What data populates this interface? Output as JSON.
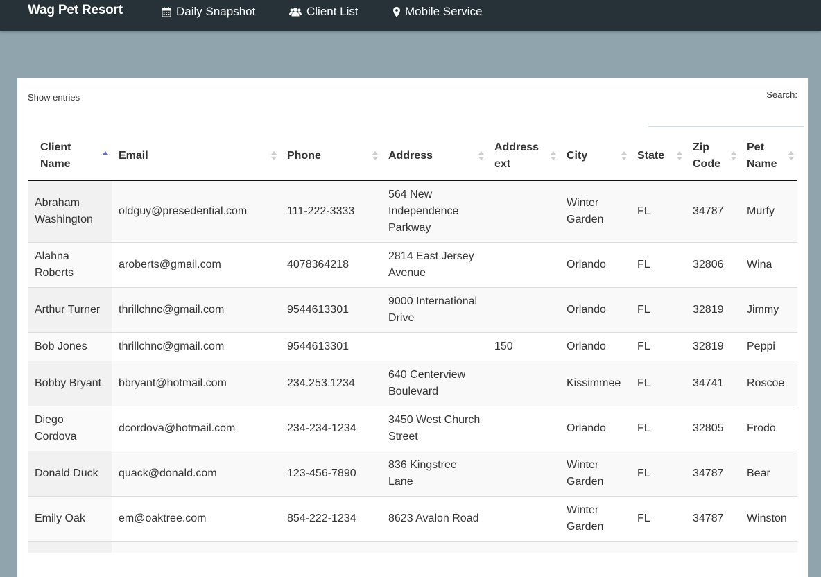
{
  "navbar": {
    "brand": "Wag Pet Resort",
    "items": [
      {
        "label": "Daily Snapshot",
        "icon": "calendar-icon"
      },
      {
        "label": "Client List",
        "icon": "users-icon"
      },
      {
        "label": "Mobile Service",
        "icon": "map-marker-icon"
      }
    ]
  },
  "colors": {
    "navbar_bg": "#263238",
    "page_bg": "#90a4ae",
    "sort_active": "#5f6ec7"
  },
  "table_controls": {
    "show_entries": "Show entries",
    "search_label": "Search:",
    "search_value": ""
  },
  "table": {
    "columns": [
      "Client Name",
      "Email",
      "Phone",
      "Address",
      "Address ext",
      "City",
      "State",
      "Zip Code",
      "Pet Name"
    ],
    "sorted_column": "Client Name",
    "sort_direction": "ascending",
    "rows": [
      [
        "Abraham Washington",
        "oldguy@presedential.com",
        "111-222-3333",
        "564 New Independence Parkway",
        "",
        "Winter Garden",
        "FL",
        "34787",
        "Murfy"
      ],
      [
        "Alahna Roberts",
        "aroberts@gmail.com",
        "4078364218",
        "2814 East Jersey Avenue",
        "",
        "Orlando",
        "FL",
        "32806",
        "Wina"
      ],
      [
        "Arthur Turner",
        "thrillchnc@gmail.com",
        "9544613301",
        "9000 International Drive",
        "",
        "Orlando",
        "FL",
        "32819",
        "Jimmy"
      ],
      [
        "Bob Jones",
        "thrillchnc@gmail.com",
        "9544613301",
        "",
        "150",
        "Orlando",
        "FL",
        "32819",
        "Peppi"
      ],
      [
        "Bobby Bryant",
        "bbryant@hotmail.com",
        "234.253.1234",
        "640 Centerview Boulevard",
        "",
        "Kissimmee",
        "FL",
        "34741",
        "Roscoe"
      ],
      [
        "Diego Cordova",
        "dcordova@hotmail.com",
        "234-234-1234",
        "3450 West Church Street",
        "",
        "Orlando",
        "FL",
        "32805",
        "Frodo"
      ],
      [
        "Donald Duck",
        "quack@donald.com",
        "123-456-7890",
        "836 Kingstree Lane",
        "",
        "Winter Garden",
        "FL",
        "34787",
        "Bear"
      ],
      [
        "Emily Oak",
        "em@oaktree.com",
        "854-222-1234",
        "8623 Avalon Road",
        "",
        "Winter Garden",
        "FL",
        "34787",
        "Winston"
      ],
      [
        "",
        "",
        "",
        "",
        "",
        "",
        "",
        "",
        ""
      ]
    ]
  }
}
